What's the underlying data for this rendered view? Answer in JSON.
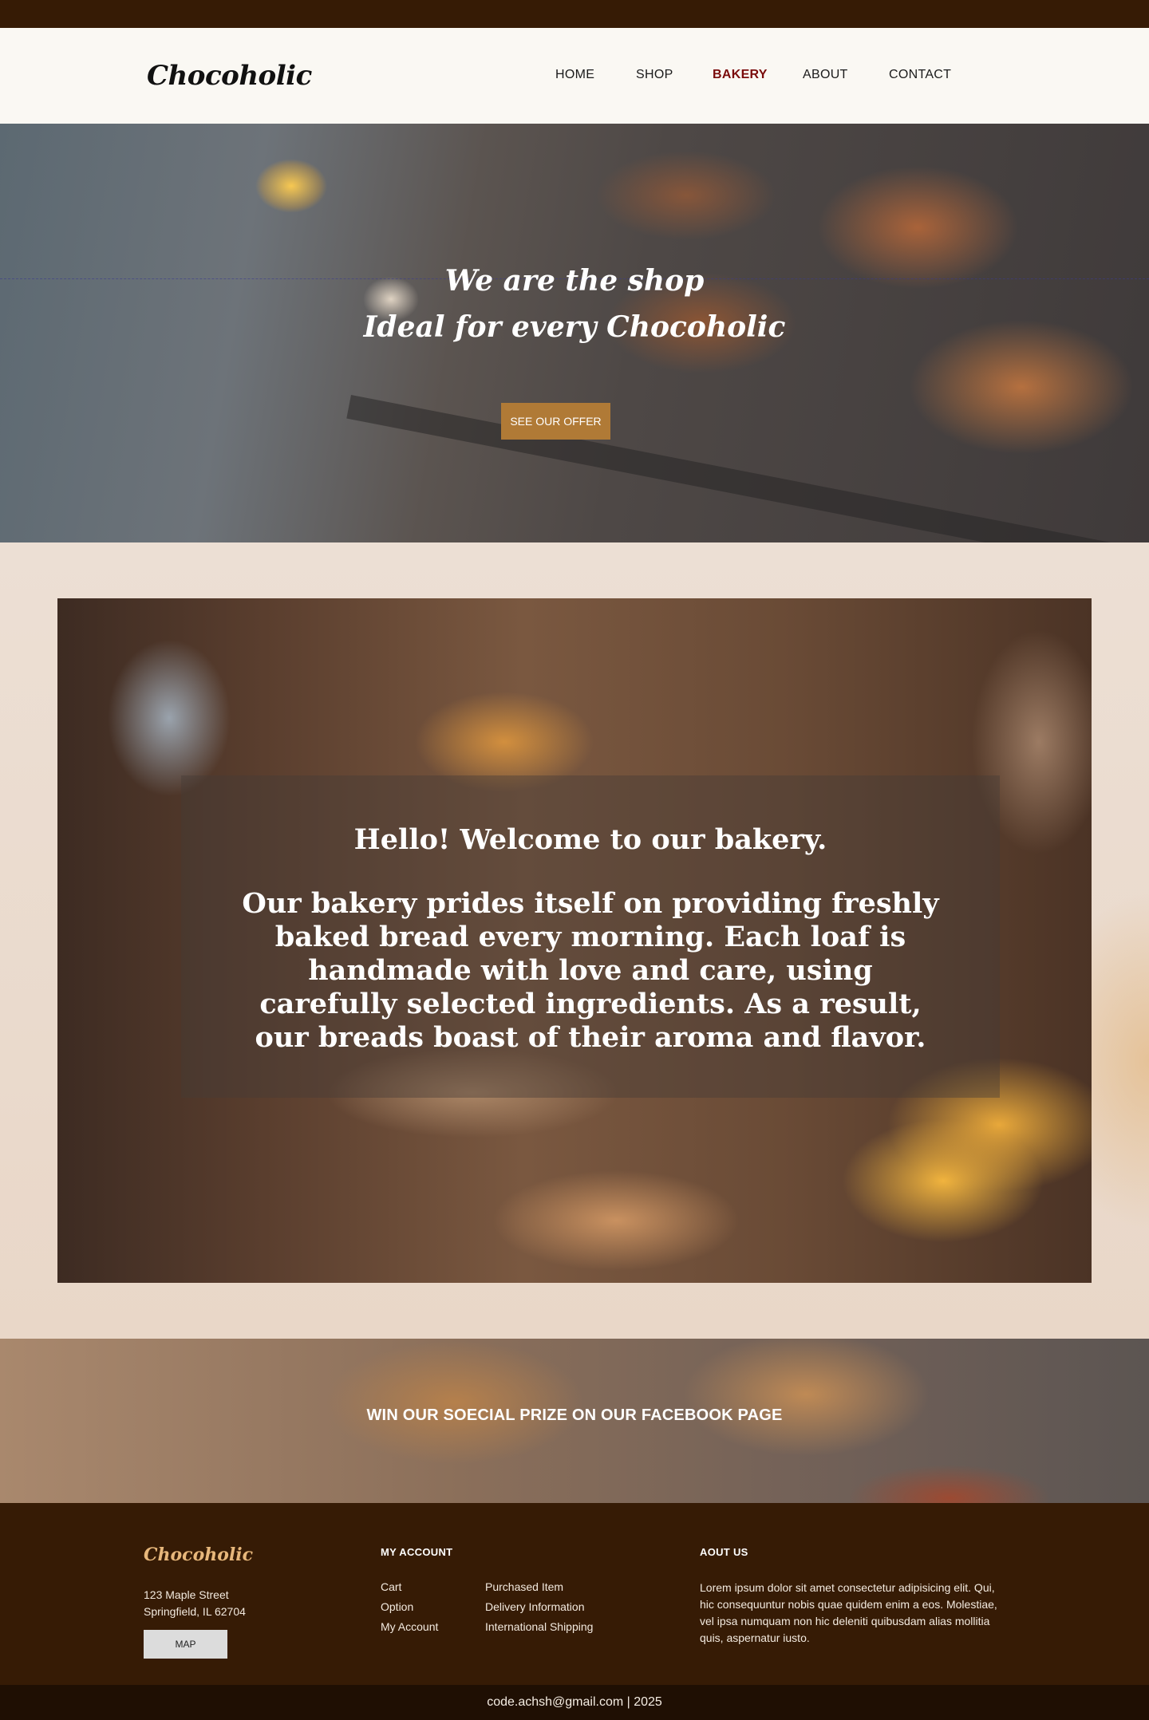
{
  "brand": {
    "name": "Chocoholic"
  },
  "nav": {
    "items": [
      {
        "label": "HOME"
      },
      {
        "label": "SHOP"
      },
      {
        "label": "BAKERY"
      },
      {
        "label": "ABOUT"
      },
      {
        "label": "CONTACT"
      }
    ],
    "active": "BAKERY"
  },
  "hero": {
    "title_line1": "We are the shop",
    "title_line2": "Ideal for every Chocoholic",
    "cta_label": "SEE OUR OFFER"
  },
  "welcome": {
    "heading": "Hello! Welcome to our bakery.",
    "body": "Our bakery prides itself on providing freshly baked bread every morning. Each loaf is handmade with love and care, using carefully selected ingredients. As a result, our breads boast of their aroma and flavor."
  },
  "promo": {
    "text": "WIN OUR SOECIAL PRIZE ON OUR FACEBOOK PAGE"
  },
  "footer": {
    "logo": "Chocoholic",
    "address_line1": "123 Maple Street",
    "address_line2": "Springfield, IL 62704",
    "map_label": "MAP",
    "account_heading": "MY ACCOUNT",
    "account_links_col1": [
      "Cart",
      "Option",
      "My Account"
    ],
    "account_links_col2": [
      "Purchased Item",
      "Delivery Information",
      "International Shipping"
    ],
    "about_heading": "AOUT US",
    "about_text": "Lorem ipsum dolor sit amet consectetur adipisicing elit. Qui, hic consequuntur nobis quae quidem enim a eos. Molestiae, vel ipsa numquam non hic deleniti quibusdam alias mollitia quis, aspernatur iusto."
  },
  "copyright": {
    "text": "code.achsh@gmail.com | 2025"
  },
  "colors": {
    "topbar": "#361b05",
    "nav_active": "#7a0b0b",
    "cta": "#b07a36",
    "footer_bg": "#361b05",
    "footer_logo": "#e7b77b",
    "copyright_bg": "#1f0f03"
  }
}
